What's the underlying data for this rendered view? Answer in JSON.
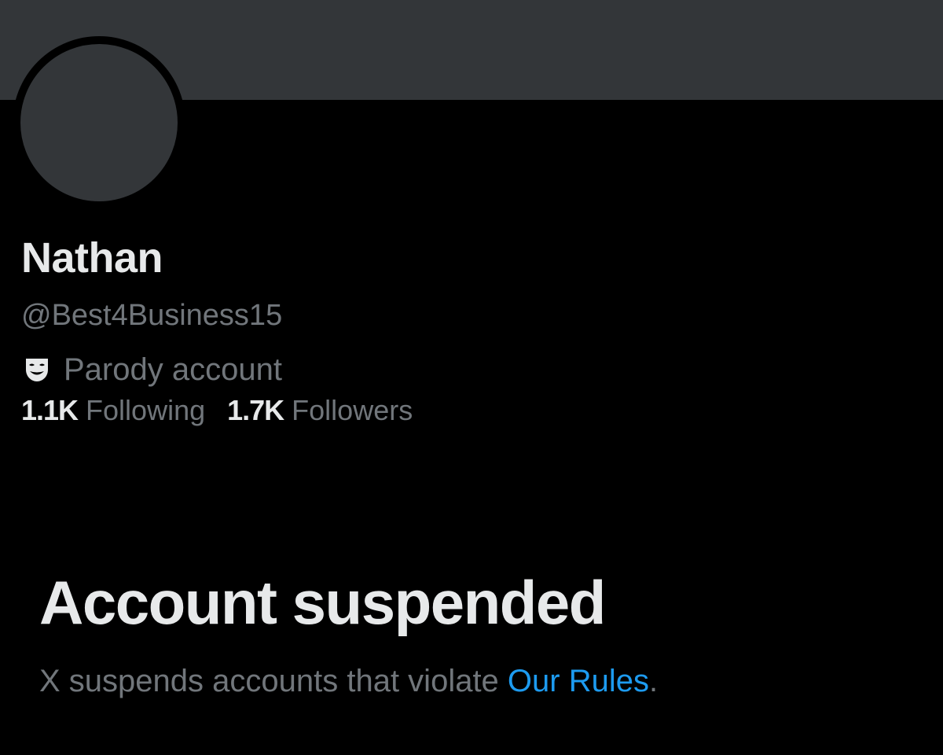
{
  "profile": {
    "display_name": "Nathan",
    "handle": "@Best4Business15",
    "parody_label": "Parody account",
    "parody_icon": "theater-mask-icon",
    "following_count": "1.1K",
    "following_label": "Following",
    "followers_count": "1.7K",
    "followers_label": "Followers"
  },
  "suspension": {
    "title": "Account suspended",
    "description_prefix": "X suspends accounts that violate ",
    "rules_link_text": "Our Rules",
    "description_suffix": "."
  },
  "colors": {
    "background": "#000000",
    "banner": "#333639",
    "primary_text": "#e7e9ea",
    "secondary_text": "#71767b",
    "link": "#1d9bf0"
  }
}
